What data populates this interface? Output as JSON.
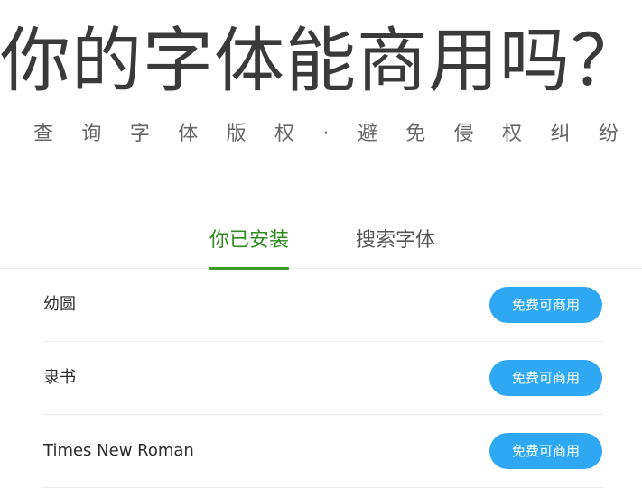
{
  "hero": {
    "title": "你的字体能商用吗？",
    "subtitle_chars": [
      "查",
      "询",
      "字",
      "体",
      "版",
      "权",
      "·",
      "避",
      "免",
      "侵",
      "权",
      "纠",
      "纷"
    ]
  },
  "tabs": [
    {
      "label": "你已安装",
      "active": true
    },
    {
      "label": "搜索字体",
      "active": false
    }
  ],
  "fonts": [
    {
      "name": "幼圆",
      "license_label": "免费可商用"
    },
    {
      "name": "隶书",
      "license_label": "免费可商用"
    },
    {
      "name": "Times New Roman",
      "license_label": "免费可商用"
    }
  ],
  "colors": {
    "accent_green": "#3a9b29",
    "button_blue": "#2fa8f3",
    "divider": "#ececec"
  }
}
